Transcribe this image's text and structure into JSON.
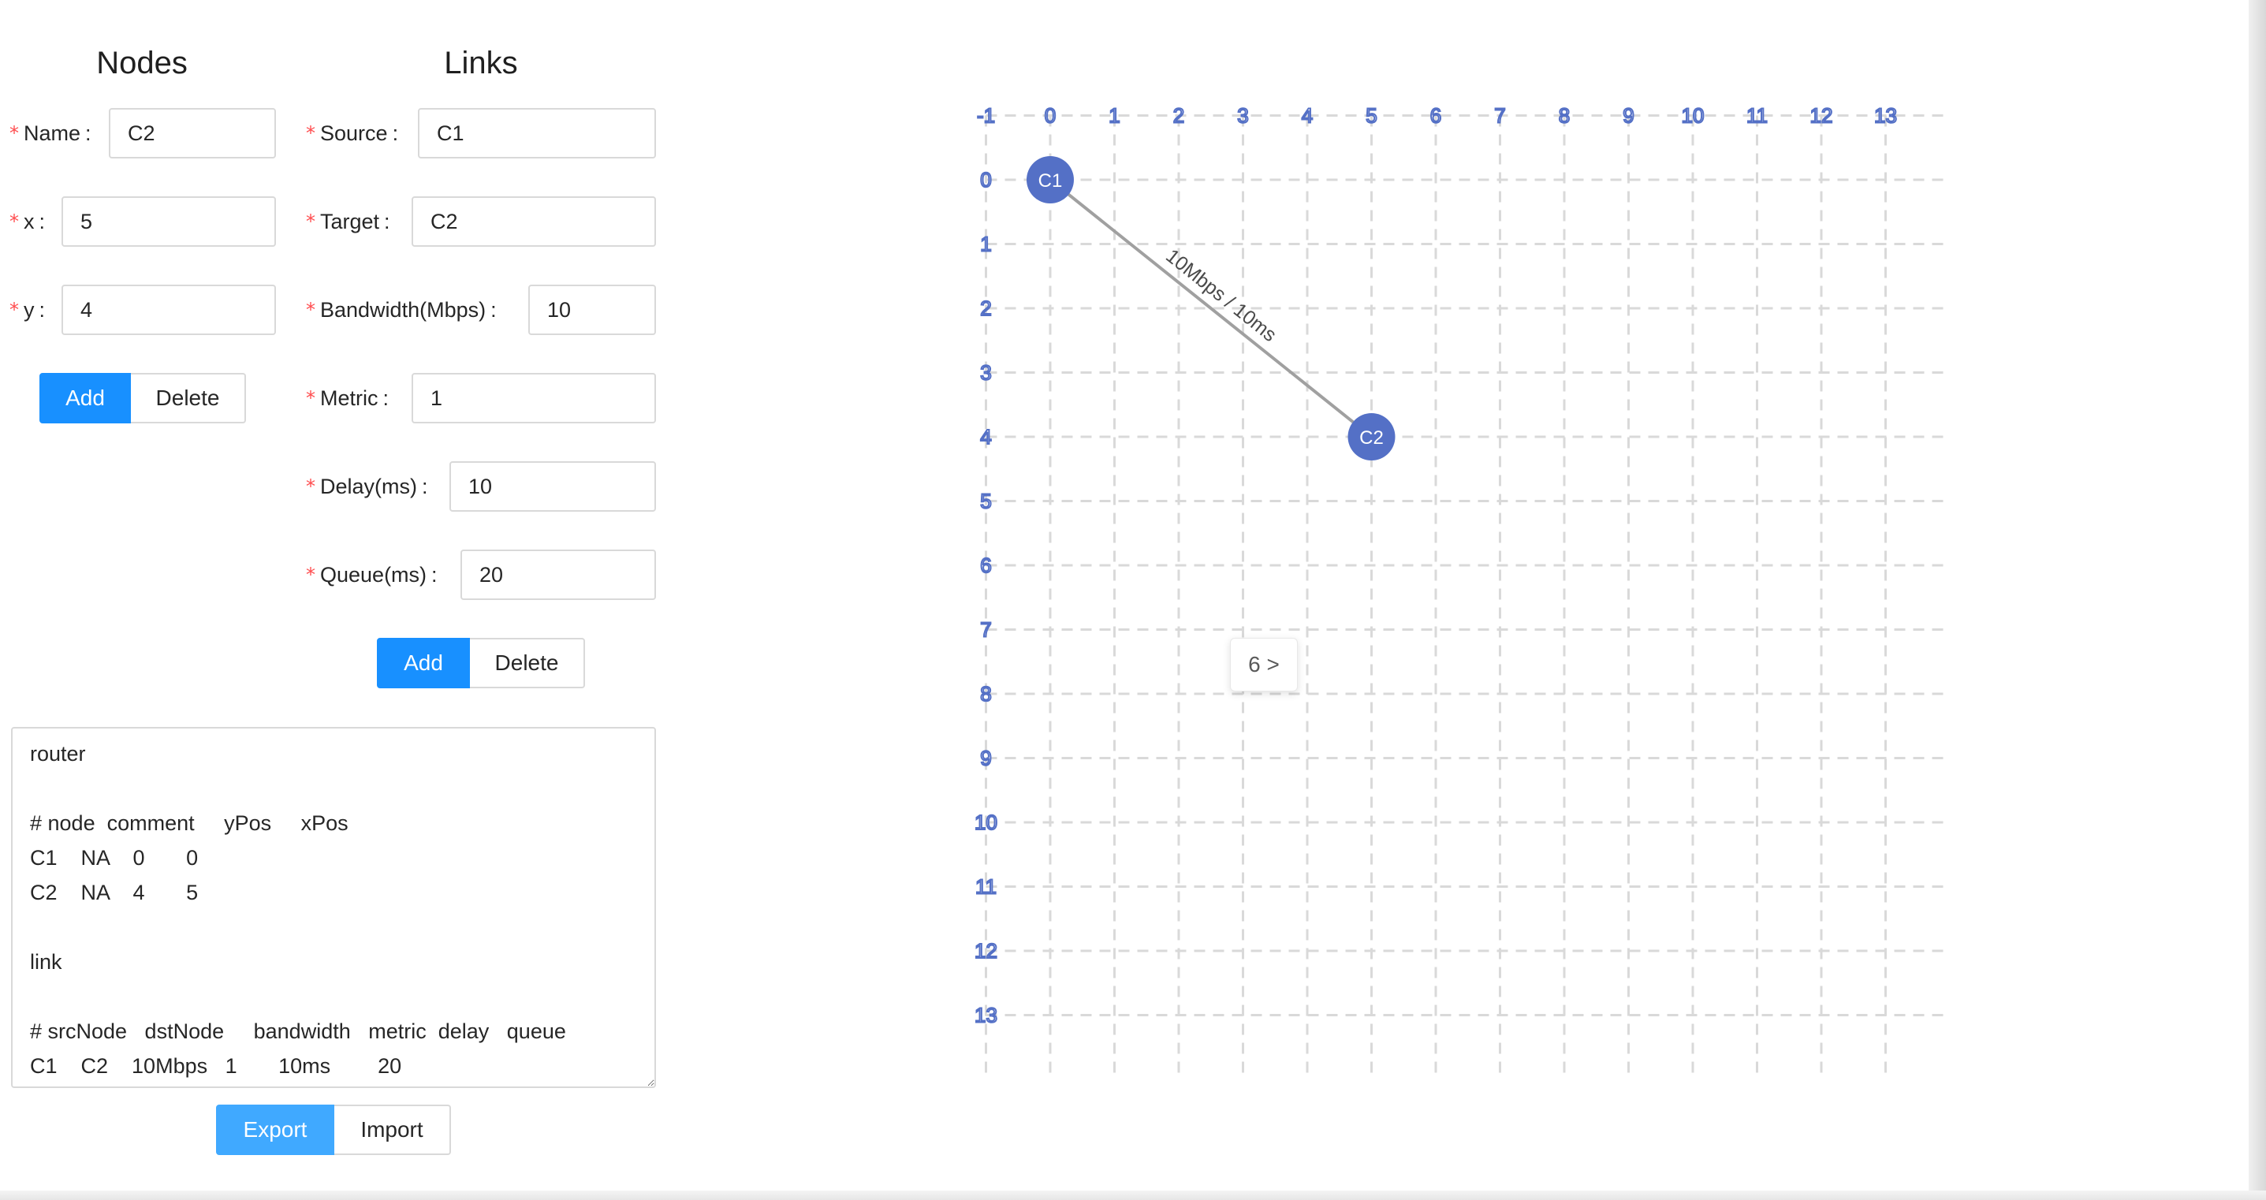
{
  "nodes_panel": {
    "title": "Nodes",
    "name": {
      "label": "Name",
      "value": "C2"
    },
    "x": {
      "label": "x",
      "value": "5"
    },
    "y": {
      "label": "y",
      "value": "4"
    },
    "add_label": "Add",
    "delete_label": "Delete"
  },
  "links_panel": {
    "title": "Links",
    "source": {
      "label": "Source",
      "value": "C1"
    },
    "target": {
      "label": "Target",
      "value": "C2"
    },
    "bandwidth": {
      "label": "Bandwidth(Mbps)",
      "value": "10"
    },
    "metric": {
      "label": "Metric",
      "value": "1"
    },
    "delay": {
      "label": "Delay(ms)",
      "value": "10"
    },
    "queue": {
      "label": "Queue(ms)",
      "value": "20"
    },
    "add_label": "Add",
    "delete_label": "Delete"
  },
  "topology_text": "router\n\n# node  comment     yPos     xPos\nC1    NA    0       0\nC2    NA    4       5\n\nlink\n\n# srcNode   dstNode     bandwidth   metric  delay   queue\nC1    C2    10Mbps   1       10ms        20",
  "export_label": "Export",
  "import_label": "Import",
  "graph": {
    "x_ticks": [
      "-1",
      "0",
      "1",
      "2",
      "3",
      "4",
      "5",
      "6",
      "7",
      "8",
      "9",
      "10",
      "11",
      "12",
      "13"
    ],
    "y_ticks": [
      "0",
      "1",
      "2",
      "3",
      "4",
      "5",
      "6",
      "7",
      "8",
      "9",
      "10",
      "11",
      "12",
      "13"
    ],
    "nodes": [
      {
        "name": "C1",
        "x": 0,
        "y": 0
      },
      {
        "name": "C2",
        "x": 5,
        "y": 4
      }
    ],
    "links": [
      {
        "source": "C1",
        "target": "C2",
        "label": "10Mbps / 10ms"
      }
    ],
    "node_color": "#5470c6",
    "tick_color": "#5470c6",
    "grid_color": "#d9d9d9",
    "link_color": "#a0a0a0"
  },
  "pager_label": "6 >"
}
